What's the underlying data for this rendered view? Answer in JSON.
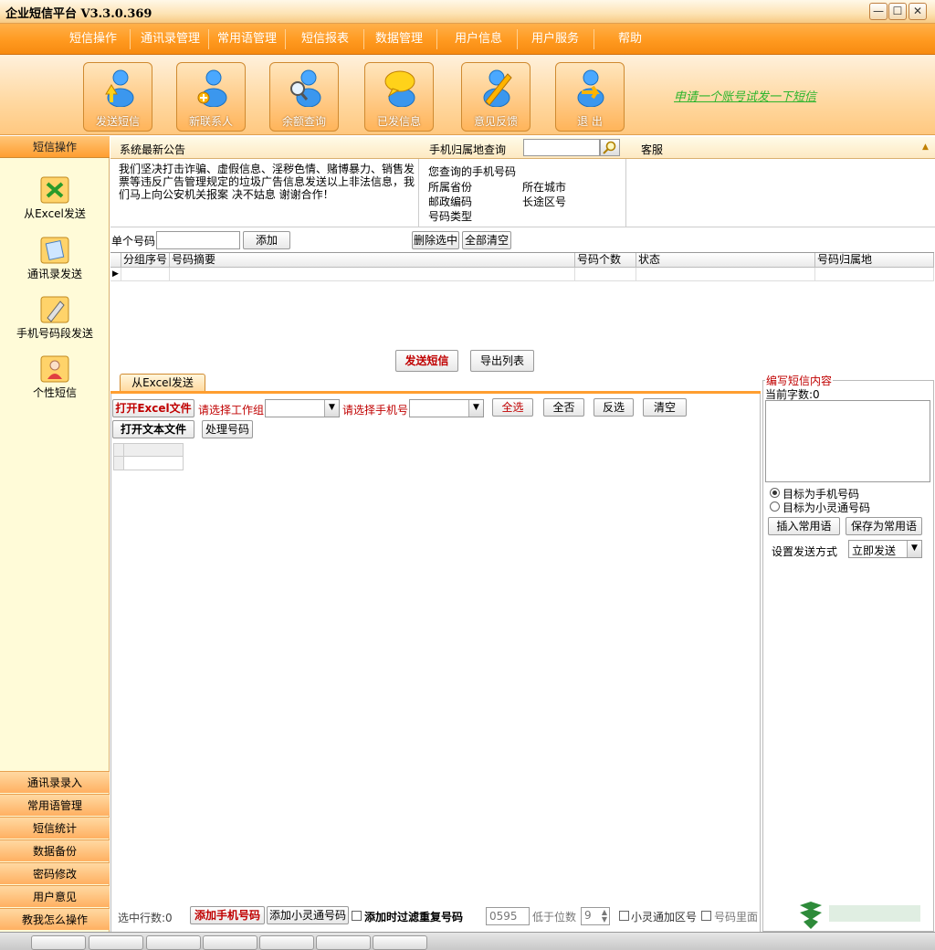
{
  "window": {
    "title": "企业短信平台 V3.3.0.369",
    "min": "—",
    "max": "☐",
    "close": "✕"
  },
  "menu": [
    "短信操作",
    "通讯录管理",
    "常用语管理",
    "短信报表",
    "数据管理",
    "用户信息",
    "用户服务",
    "帮助"
  ],
  "toolbar": {
    "buttons": [
      "发送短信",
      "新联系人",
      "余额查询",
      "已发信息",
      "意见反馈",
      "退 出"
    ],
    "trial_link": "申请一个账号试发一下短信"
  },
  "sidebar": {
    "header": "短信操作",
    "items": [
      "从Excel发送",
      "通讯录发送",
      "手机号码段发送",
      "个性短信"
    ],
    "nav": [
      "通讯录录入",
      "常用语管理",
      "短信统计",
      "数据备份",
      "密码修改",
      "用户意见",
      "教我怎么操作"
    ]
  },
  "notice": {
    "title": "系统最新公告",
    "body": "我们坚决打击诈骗、虚假信息、淫秽色情、赌博暴力、销售发票等违反广告管理规定的垃圾广告信息发送以上非法信息，我们马上向公安机关报案 决不姑息 谢谢合作！"
  },
  "phone_lookup": {
    "title": "手机归属地查询",
    "query_label": "您查询的手机号码",
    "province": "所属省份",
    "city": "所在城市",
    "postcode": "邮政编码",
    "area_code": "长途区号",
    "type": "号码类型"
  },
  "service": {
    "title": "客服"
  },
  "number_entry": {
    "label": "单个号码",
    "value": "",
    "add": "添加",
    "delete_selected": "删除选中",
    "clear_all": "全部清空"
  },
  "grid": {
    "columns": [
      "分组序号",
      "号码摘要",
      "号码个数",
      "状态",
      "号码归属地"
    ]
  },
  "actions": {
    "send": "发送短信",
    "export": "导出列表"
  },
  "tab": {
    "label": "从Excel发送"
  },
  "excel": {
    "open_excel": "打开Excel文件",
    "select_group": "请选择工作组",
    "select_phone": "请选择手机号",
    "select_all": "全选",
    "select_none": "全否",
    "invert": "反选",
    "clear": "清空",
    "open_text": "打开文本文件",
    "process": "处理号码"
  },
  "bottom": {
    "selected_rows": "选中行数:0",
    "add_phone": "添加手机号码",
    "add_xlt": "添加小灵通号码",
    "filter_dup": "添加时过滤重复号码",
    "prefix_value": "0595",
    "digits_label": "低于位数",
    "digits_value": "9",
    "xlt_area": "小灵通加区号",
    "number_inside": "号码里面"
  },
  "editor": {
    "legend": "编写短信内容",
    "char_count": "当前字数:0",
    "target_mobile": "目标为手机号码",
    "target_xlt": "目标为小灵通号码",
    "insert_phrase": "插入常用语",
    "save_phrase": "保存为常用语",
    "send_mode_label": "设置发送方式",
    "send_mode_value": "立即发送"
  },
  "colors": {
    "accent": "#ff9e30",
    "link": "#2db52d",
    "warn": "#c00000"
  }
}
